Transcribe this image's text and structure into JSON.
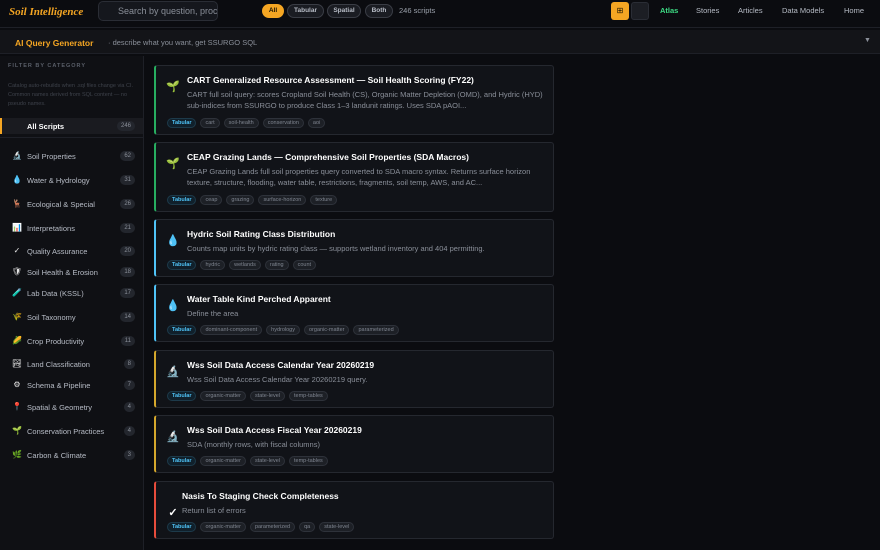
{
  "header": {
    "brand": "Soil Intelligence",
    "search_placeholder": "Search by question, procedure, or tag",
    "filters": [
      "All",
      "Tabular",
      "Spatial",
      "Both"
    ],
    "count_text": "246 scripts",
    "nav": [
      "Atlas",
      "Stories",
      "Articles",
      "Data Models",
      "Home"
    ],
    "active_nav": "Atlas"
  },
  "ai_bar": {
    "title": "AI Query Generator",
    "subtitle": "· describe what you want, get SSURGO SQL",
    "toggle_icon": "chevron-down-icon"
  },
  "sidebar": {
    "heading": "FILTER BY CATEGORY",
    "description": "Catalog auto-rebuilds when .sql files change via CI. Common names derived from SQL content — no pseudo names.",
    "all": {
      "label": "All Scripts",
      "count": "246"
    },
    "items": [
      {
        "icon": "microscope-icon",
        "glyph": "🔬",
        "label": "Soil Properties",
        "count": "62"
      },
      {
        "icon": "droplet-icon",
        "glyph": "💧",
        "label": "Water & Hydrology",
        "count": "31"
      },
      {
        "icon": "deer-icon",
        "glyph": "🦌",
        "label": "Ecological & Special",
        "count": "26"
      },
      {
        "icon": "chart-icon",
        "glyph": "📊",
        "label": "Interpretations",
        "count": "21"
      },
      {
        "icon": "checkmark-icon",
        "glyph": "✓",
        "label": "Quality Assurance",
        "count": "20"
      },
      {
        "icon": "shield-icon",
        "glyph": "🛡",
        "label": "Soil Health & Erosion",
        "count": "18"
      },
      {
        "icon": "test-tube-icon",
        "glyph": "🧪",
        "label": "Lab Data (KSSL)",
        "count": "17"
      },
      {
        "icon": "wheat-icon",
        "glyph": "🌾",
        "label": "Soil Taxonomy",
        "count": "14"
      },
      {
        "icon": "corn-icon",
        "glyph": "🌽",
        "label": "Crop Productivity",
        "count": "11"
      },
      {
        "icon": "landscape-icon",
        "glyph": "🏞",
        "label": "Land Classification",
        "count": "8"
      },
      {
        "icon": "gear-icon",
        "glyph": "⚙",
        "label": "Schema & Pipeline",
        "count": "7"
      },
      {
        "icon": "pin-icon",
        "glyph": "📍",
        "label": "Spatial & Geometry",
        "count": "4"
      },
      {
        "icon": "seedling-icon",
        "glyph": "🌱",
        "label": "Conservation Practices",
        "count": "4"
      },
      {
        "icon": "herb-icon",
        "glyph": "🌿",
        "label": "Carbon & Climate",
        "count": "3"
      }
    ]
  },
  "colors": {
    "accent": "#f5a623",
    "atlas_active": "#3ddc84",
    "green": "#27ae60",
    "blue": "#4fc3f7",
    "yellow": "#d4a72c",
    "red": "#e74c3c"
  },
  "cards": [
    {
      "icon": "seedling-icon",
      "glyph": "🌱",
      "accent": "#27ae60",
      "title": "CART Generalized Resource Assessment — Soil Health Scoring (FY22)",
      "description": "CART full soil query: scores Cropland Soil Health (CS), Organic Matter Depletion (OMD), and Hydric (HYD) sub-indices from SSURGO to produce Class 1–3 landunit ratings. Uses SDA pAOI...",
      "tags": [
        "Tabular",
        "cart",
        "soil-health",
        "conservation",
        "aoi"
      ]
    },
    {
      "icon": "seedling-icon",
      "glyph": "🌱",
      "accent": "#27ae60",
      "title": "CEAP Grazing Lands — Comprehensive Soil Properties (SDA Macros)",
      "description": "CEAP Grazing Lands full soil properties query converted to SDA macro syntax. Returns surface horizon texture, structure, flooding, water table, restrictions, fragments, soil temp, AWS, and AC...",
      "tags": [
        "Tabular",
        "ceap",
        "grazing",
        "surface-horizon",
        "texture"
      ]
    },
    {
      "icon": "droplet-icon",
      "glyph": "💧",
      "accent": "#4fc3f7",
      "title": "Hydric Soil Rating Class Distribution",
      "description": "Counts map units by hydric rating class — supports wetland inventory and 404 permitting.",
      "tags": [
        "Tabular",
        "hydric",
        "wetlands",
        "rating",
        "count"
      ]
    },
    {
      "icon": "droplet-icon",
      "glyph": "💧",
      "accent": "#4fc3f7",
      "title": "Water Table Kind Perched Apparent",
      "description": "Define the area",
      "tags": [
        "Tabular",
        "dominant-component",
        "hydrology",
        "organic-matter",
        "parameterized"
      ]
    },
    {
      "icon": "microscope-icon",
      "glyph": "🔬",
      "accent": "#d4a72c",
      "title": "Wss Soil Data Access Calendar Year 20260219",
      "description": "Wss Soil Data Access Calendar Year 20260219 query.",
      "tags": [
        "Tabular",
        "organic-matter",
        "state-level",
        "temp-tables"
      ]
    },
    {
      "icon": "microscope-icon",
      "glyph": "🔬",
      "accent": "#d4a72c",
      "title": "Wss Soil Data Access Fiscal Year 20260219",
      "description": "SDA (monthly rows, with fiscal columns)",
      "tags": [
        "Tabular",
        "organic-matter",
        "state-level",
        "temp-tables"
      ]
    },
    {
      "icon": "checkmark-icon",
      "glyph": "✓",
      "accent": "#e74c3c",
      "title": "Nasis To Staging Check Completeness",
      "description": "Return list of errors",
      "tags": [
        "Tabular",
        "organic-matter",
        "parameterized",
        "qa",
        "state-level"
      ]
    }
  ]
}
